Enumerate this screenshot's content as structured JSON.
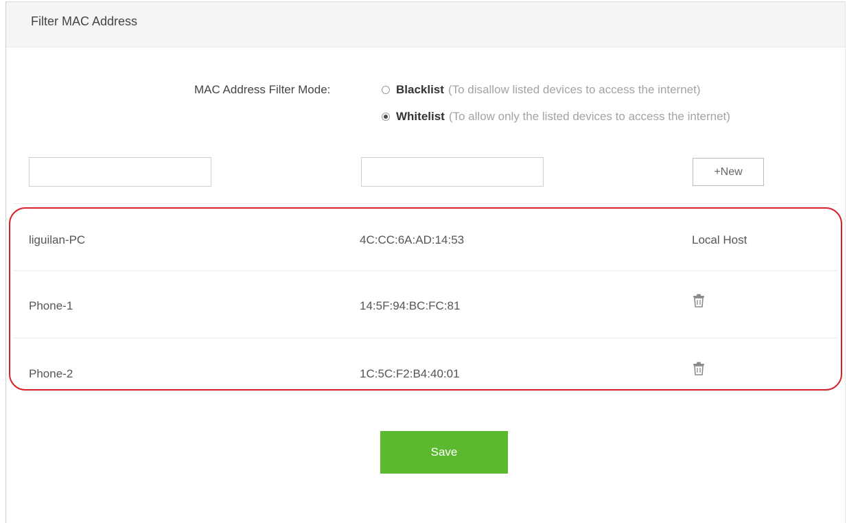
{
  "panel": {
    "title": "Filter MAC Address"
  },
  "filter_mode": {
    "label": "MAC Address Filter Mode:",
    "selected": "Whitelist",
    "options": [
      {
        "name": "Blacklist",
        "description": "(To disallow listed devices to access the internet)",
        "checked": false
      },
      {
        "name": "Whitelist",
        "description": "(To allow only the listed devices to access the internet)",
        "checked": true
      }
    ]
  },
  "new_entry": {
    "name_value": "",
    "mac_value": "",
    "new_label": "+New"
  },
  "devices": [
    {
      "name": "liguilan-PC",
      "mac": "4C:CC:6A:AD:14:53",
      "action": "Local Host"
    },
    {
      "name": "Phone-1",
      "mac": "14:5F:94:BC:FC:81",
      "action_icon": "trash-icon"
    },
    {
      "name": "Phone-2",
      "mac": "1C:5C:F2:B4:40:01",
      "action_icon": "trash-icon"
    }
  ],
  "save_label": "Save",
  "colors": {
    "save": "#5cb82e",
    "highlight": "#d9202a",
    "header_bg": "#f5f5f5"
  }
}
